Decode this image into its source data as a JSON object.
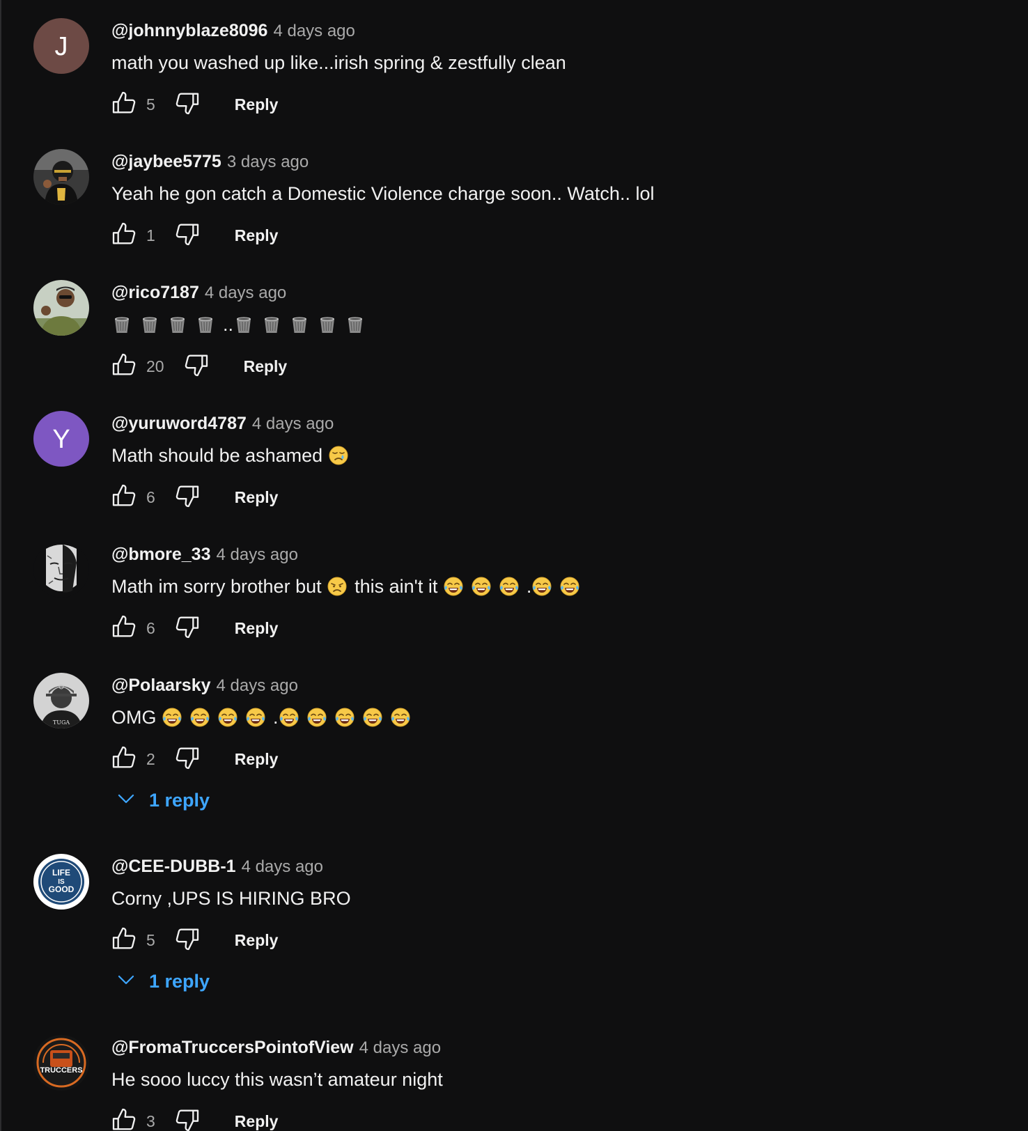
{
  "comments": [
    {
      "author": "@johnnyblaze8096",
      "time": "4 days ago",
      "likes": "5",
      "reply_label": "Reply",
      "avatar": {
        "kind": "letter",
        "letter": "J",
        "color": "#6d4a45"
      },
      "text_parts": [
        {
          "t": "math you washed up like...irish spring & zestfully clean"
        }
      ]
    },
    {
      "author": "@jaybee5775",
      "time": "3 days ago",
      "likes": "1",
      "reply_label": "Reply",
      "avatar": {
        "kind": "photo",
        "icon": "football-player-avatar"
      },
      "text_parts": [
        {
          "t": "Yeah he gon catch a Domestic Violence charge soon.. Watch.. lol"
        }
      ]
    },
    {
      "author": "@rico7187",
      "time": "4 days ago",
      "likes": "20",
      "reply_label": "Reply",
      "avatar": {
        "kind": "photo",
        "icon": "man-green-jacket-avatar"
      },
      "text_parts": [
        {
          "e": "wastebasket-icon"
        },
        {
          "e": "wastebasket-icon"
        },
        {
          "e": "wastebasket-icon"
        },
        {
          "e": "wastebasket-icon"
        },
        {
          "t": ".."
        },
        {
          "e": "wastebasket-icon"
        },
        {
          "e": "wastebasket-icon"
        },
        {
          "e": "wastebasket-icon"
        },
        {
          "e": "wastebasket-icon"
        },
        {
          "e": "wastebasket-icon"
        }
      ]
    },
    {
      "author": "@yuruword4787",
      "time": "4 days ago",
      "likes": "6",
      "reply_label": "Reply",
      "avatar": {
        "kind": "letter",
        "letter": "Y",
        "color": "#7e57c2"
      },
      "text_parts": [
        {
          "t": "Math should be ashamed "
        },
        {
          "e": "sad-tear-face-icon"
        }
      ]
    },
    {
      "author": "@bmore_33",
      "time": "4 days ago",
      "likes": "6",
      "reply_label": "Reply",
      "avatar": {
        "kind": "photo",
        "icon": "portrait-sketch-avatar"
      },
      "text_parts": [
        {
          "t": "Math im sorry brother but "
        },
        {
          "e": "disappointed-face-icon"
        },
        {
          "t": "this ain't it "
        },
        {
          "e": "tears-of-joy-face-icon"
        },
        {
          "e": "tears-of-joy-face-icon"
        },
        {
          "e": "tears-of-joy-face-icon"
        },
        {
          "t": "."
        },
        {
          "e": "tears-of-joy-face-icon"
        },
        {
          "e": "tears-of-joy-face-icon"
        }
      ]
    },
    {
      "author": "@Polaarsky",
      "time": "4 days ago",
      "likes": "2",
      "reply_label": "Reply",
      "avatar": {
        "kind": "photo",
        "icon": "man-cap-avatar"
      },
      "replies_label": "1 reply",
      "text_parts": [
        {
          "t": "OMG "
        },
        {
          "e": "tears-of-joy-face-icon"
        },
        {
          "e": "tears-of-joy-face-icon"
        },
        {
          "e": "tears-of-joy-face-icon"
        },
        {
          "e": "tears-of-joy-face-icon"
        },
        {
          "t": "."
        },
        {
          "e": "tears-of-joy-face-icon"
        },
        {
          "e": "tears-of-joy-face-icon"
        },
        {
          "e": "tears-of-joy-face-icon"
        },
        {
          "e": "tears-of-joy-face-icon"
        },
        {
          "e": "tears-of-joy-face-icon"
        }
      ]
    },
    {
      "author": "@CEE-DUBB-1",
      "time": "4 days ago",
      "likes": "5",
      "reply_label": "Reply",
      "avatar": {
        "kind": "logo",
        "icon": "life-is-good-logo-avatar",
        "logo_text": [
          "LIFE",
          "IS",
          "GOOD"
        ]
      },
      "replies_label": "1 reply",
      "text_parts": [
        {
          "t": "Corny ,UPS IS HIRING BRO"
        }
      ]
    },
    {
      "author": "@FromaTruccersPointofView",
      "time": "4 days ago",
      "likes": "3",
      "reply_label": "Reply",
      "avatar": {
        "kind": "logo",
        "icon": "truccers-logo-avatar",
        "logo_text": [
          "TRUCCERS"
        ]
      },
      "text_parts": [
        {
          "t": "He sooo luccy this wasn’t amateur night"
        }
      ]
    }
  ],
  "colors": {
    "background": "#0f0f10",
    "text": "#f1f1f1",
    "secondary_text": "#aaaaaa",
    "link_blue": "#3ea6ff"
  }
}
